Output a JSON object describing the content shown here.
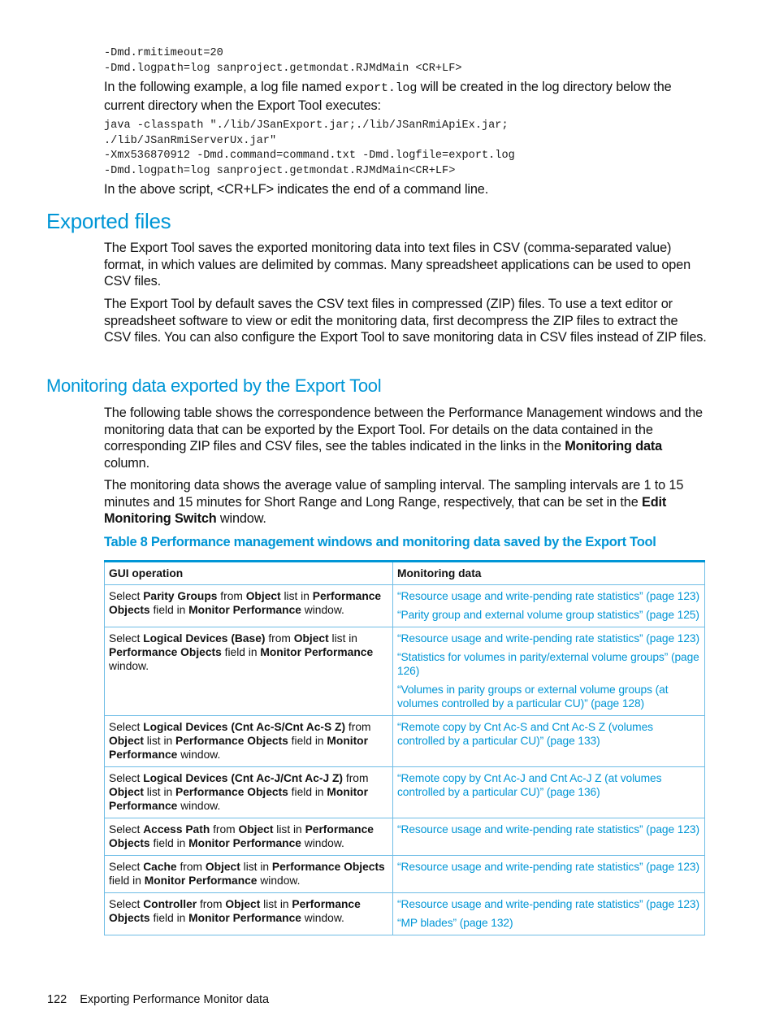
{
  "code_block_1": [
    "-Dmd.rmitimeout=20",
    "-Dmd.logpath=log sanproject.getmondat.RJMdMain <CR+LF>"
  ],
  "para_log_example": {
    "before": "In the following example, a log file named ",
    "code": "export.log",
    "after": " will be created in the log directory below the current directory when the Export Tool executes:"
  },
  "code_block_2": [
    "java -classpath \"./lib/JSanExport.jar;./lib/JSanRmiApiEx.jar;",
    "./lib/JSanRmiServerUx.jar\"",
    "-Xmx536870912 -Dmd.command=command.txt -Dmd.logfile=export.log",
    "-Dmd.logpath=log sanproject.getmondat.RJMdMain<CR+LF>"
  ],
  "para_crlf": "In the above script, <CR+LF> indicates the end of a command line.",
  "section_exported_files": {
    "title": "Exported files",
    "paragraphs": [
      "The Export Tool saves the exported monitoring data into text files in CSV (comma-separated value) format, in which values are delimited by commas. Many spreadsheet applications can be used to open CSV files.",
      "The Export Tool by default saves the CSV text files in compressed (ZIP) files. To use a text editor or spreadsheet software to view or edit the monitoring data, first decompress the ZIP files to extract the CSV files. You can also configure the Export Tool to save monitoring data in CSV files instead of ZIP files."
    ]
  },
  "section_monitoring": {
    "title": "Monitoring data exported by the Export Tool",
    "para1": {
      "text": "The following table shows the correspondence between the Performance Management windows and the monitoring data that can be exported by the Export Tool. For details on the data contained in the corresponding ZIP files and CSV files, see the tables indicated in the links in the ",
      "bold": "Monitoring data",
      "after": " column."
    },
    "para2": {
      "text": "The monitoring data shows the average value of sampling interval. The sampling intervals are 1 to 15 minutes and 15 minutes for Short Range and Long Range, respectively, that can be set in the ",
      "bold": "Edit Monitoring Switch",
      "after": " window."
    }
  },
  "table": {
    "caption": "Table 8 Performance management windows and monitoring data saved by the Export Tool",
    "headers": [
      "GUI operation",
      "Monitoring data"
    ],
    "rows": [
      {
        "op": [
          [
            "Select ",
            false
          ],
          [
            "Parity Groups",
            true
          ],
          [
            " from ",
            false
          ],
          [
            "Object",
            true
          ],
          [
            " list in ",
            false
          ],
          [
            "Performance Objects",
            true
          ],
          [
            " field in ",
            false
          ],
          [
            "Monitor Performance",
            true
          ],
          [
            " window.",
            false
          ]
        ],
        "links": [
          "“Resource usage and write-pending rate statistics” (page 123)",
          "“Parity group and external volume group statistics” (page 125)"
        ]
      },
      {
        "op": [
          [
            "Select ",
            false
          ],
          [
            "Logical Devices (Base)",
            true
          ],
          [
            " from ",
            false
          ],
          [
            "Object",
            true
          ],
          [
            " list in ",
            false
          ],
          [
            "Performance Objects",
            true
          ],
          [
            " field in ",
            false
          ],
          [
            "Monitor Performance",
            true
          ],
          [
            " window.",
            false
          ]
        ],
        "links": [
          "“Resource usage and write-pending rate statistics” (page 123)",
          "“Statistics for volumes in parity/external volume groups” (page 126)",
          "“Volumes in parity groups or external volume groups (at volumes controlled by a particular CU)” (page 128)"
        ]
      },
      {
        "op": [
          [
            "Select ",
            false
          ],
          [
            "Logical Devices (Cnt Ac-S/Cnt Ac-S Z)",
            true
          ],
          [
            " from ",
            false
          ],
          [
            "Object",
            true
          ],
          [
            " list in ",
            false
          ],
          [
            "Performance Objects",
            true
          ],
          [
            " field in ",
            false
          ],
          [
            "Monitor Performance",
            true
          ],
          [
            " window.",
            false
          ]
        ],
        "links": [
          "“Remote copy by Cnt Ac-S and Cnt Ac-S Z (volumes controlled by a particular CU)” (page 133)"
        ]
      },
      {
        "op": [
          [
            "Select ",
            false
          ],
          [
            "Logical Devices (Cnt Ac-J/Cnt Ac-J Z)",
            true
          ],
          [
            " from ",
            false
          ],
          [
            "Object",
            true
          ],
          [
            " list in ",
            false
          ],
          [
            "Performance Objects",
            true
          ],
          [
            " field in ",
            false
          ],
          [
            "Monitor Performance",
            true
          ],
          [
            " window.",
            false
          ]
        ],
        "links": [
          "“Remote copy by Cnt Ac-J and Cnt Ac-J Z (at volumes controlled by a particular CU)” (page 136)"
        ]
      },
      {
        "op": [
          [
            "Select ",
            false
          ],
          [
            "Access Path",
            true
          ],
          [
            " from ",
            false
          ],
          [
            "Object",
            true
          ],
          [
            " list in ",
            false
          ],
          [
            "Performance Objects",
            true
          ],
          [
            " field in ",
            false
          ],
          [
            "Monitor Performance",
            true
          ],
          [
            " window.",
            false
          ]
        ],
        "links": [
          "“Resource usage and write-pending rate statistics” (page 123)"
        ]
      },
      {
        "op": [
          [
            "Select ",
            false
          ],
          [
            "Cache",
            true
          ],
          [
            " from ",
            false
          ],
          [
            "Object",
            true
          ],
          [
            " list in ",
            false
          ],
          [
            "Performance Objects",
            true
          ],
          [
            " field in ",
            false
          ],
          [
            "Monitor Performance",
            true
          ],
          [
            " window.",
            false
          ]
        ],
        "links": [
          "“Resource usage and write-pending rate statistics” (page 123)"
        ]
      },
      {
        "op": [
          [
            "Select ",
            false
          ],
          [
            "Controller",
            true
          ],
          [
            " from ",
            false
          ],
          [
            "Object",
            true
          ],
          [
            " list in ",
            false
          ],
          [
            "Performance Objects",
            true
          ],
          [
            " field in ",
            false
          ],
          [
            "Monitor Performance",
            true
          ],
          [
            " window.",
            false
          ]
        ],
        "links": [
          "“Resource usage and write-pending rate statistics” (page 123)",
          "“MP blades” (page 132)"
        ]
      }
    ]
  },
  "footer": {
    "page_number": "122",
    "chapter": "Exporting Performance Monitor data"
  }
}
